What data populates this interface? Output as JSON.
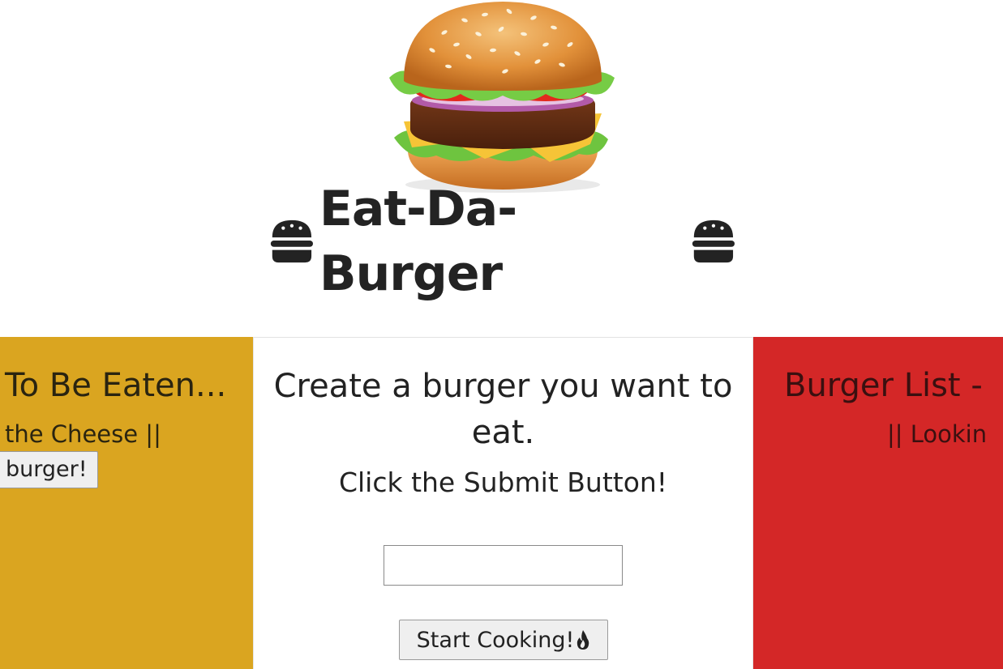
{
  "header": {
    "image_name": "burger-image",
    "title": "Eat-Da-Burger",
    "title_icon": "hamburger-icon"
  },
  "left_panel": {
    "heading": "To Be Eaten...",
    "item_text": "the Cheese ||",
    "button_label": "burger!",
    "color": "#daa520"
  },
  "center_panel": {
    "heading": "Create a burger you want to eat.",
    "subheading": "Click the Submit Button!",
    "input_value": "",
    "button_label": "Start Cooking!",
    "button_icon": "fire-icon"
  },
  "right_panel": {
    "heading": "Burger List -",
    "item_text": "|| Lookin",
    "color": "#d42727"
  }
}
